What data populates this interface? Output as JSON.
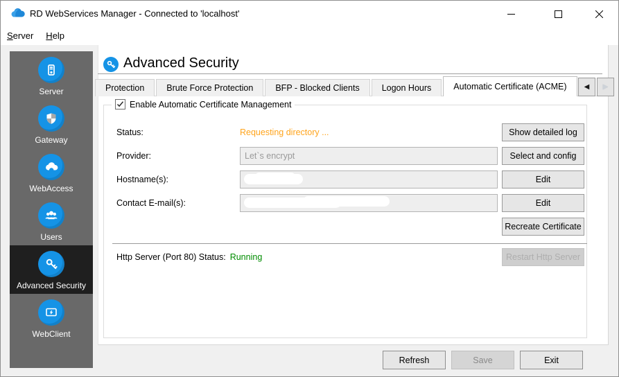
{
  "window": {
    "title": "RD WebServices Manager - Connected to 'localhost'"
  },
  "menu": {
    "items": [
      {
        "label": "Server",
        "key": "S",
        "rest": "erver"
      },
      {
        "label": "Help",
        "key": "H",
        "rest": "elp"
      }
    ]
  },
  "sidebar": {
    "items": [
      {
        "label": "Server",
        "icon": "server-icon",
        "selected": false
      },
      {
        "label": "Gateway",
        "icon": "shield-icon",
        "selected": false
      },
      {
        "label": "WebAccess",
        "icon": "cloud-icon",
        "selected": false
      },
      {
        "label": "Users",
        "icon": "users-icon",
        "selected": false
      },
      {
        "label": "Advanced Security",
        "icon": "key-icon",
        "selected": true
      },
      {
        "label": "WebClient",
        "icon": "monitor-icon",
        "selected": false
      }
    ]
  },
  "main": {
    "title": "Advanced Security",
    "tabs": [
      {
        "label": "Protection",
        "clipped": true,
        "active": false
      },
      {
        "label": "Brute Force Protection",
        "active": false
      },
      {
        "label": "BFP - Blocked Clients",
        "active": false
      },
      {
        "label": "Logon Hours",
        "active": false
      },
      {
        "label": "Automatic Certificate (ACME)",
        "active": true
      }
    ],
    "tab_scroll": {
      "left_enabled": true,
      "right_enabled": false
    },
    "group": {
      "title": "Enable Automatic Certificate Management",
      "checkbox_checked": true,
      "status_label": "Status:",
      "status_value": "Requesting directory ...",
      "status_button": "Show detailed log",
      "provider_label": "Provider:",
      "provider_value": "Let`s encrypt",
      "provider_button": "Select and config",
      "hostnames_label": "Hostname(s):",
      "hostnames_value_redacted": true,
      "hostnames_button": "Edit",
      "contacts_label": "Contact E-mail(s):",
      "contacts_value_redacted": true,
      "contacts_button": "Edit",
      "recreate_button": "Recreate Certificate",
      "http_label": "Http Server (Port 80) Status:",
      "http_value": "Running",
      "http_button": "Restart Http Server",
      "http_button_enabled": false
    },
    "footer": {
      "refresh": "Refresh",
      "save": "Save",
      "save_enabled": false,
      "exit": "Exit"
    }
  },
  "colors": {
    "accent_blue": "#1593e6",
    "status_orange": "#ffa41c",
    "status_green": "#008c00",
    "sidebar_gray": "#696969",
    "sidebar_selected": "#1f1f1f"
  }
}
